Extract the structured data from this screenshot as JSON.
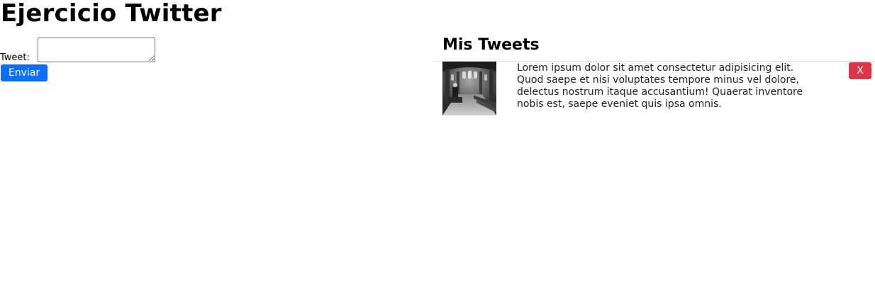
{
  "page": {
    "title": "Ejercicio Twitter"
  },
  "form": {
    "tweet_label": "Tweet:",
    "tweet_value": "",
    "send_label": "Enviar"
  },
  "tweets_panel": {
    "heading": "Mis Tweets",
    "items": [
      {
        "thumbnail": "church-interior-photo",
        "text": "Lorem ipsum dolor sit amet consectetur adipisicing elit. Quod saepe et nisi voluptates tempore minus vel dolore, delectus nostrum itaque accusantium! Quaerat inventore nobis est, saepe eveniet quis ipsa omnis.",
        "delete_label": "X"
      }
    ]
  },
  "colors": {
    "primary": "#0d6efd",
    "danger": "#dc3545",
    "divider": "#dee2e6"
  }
}
